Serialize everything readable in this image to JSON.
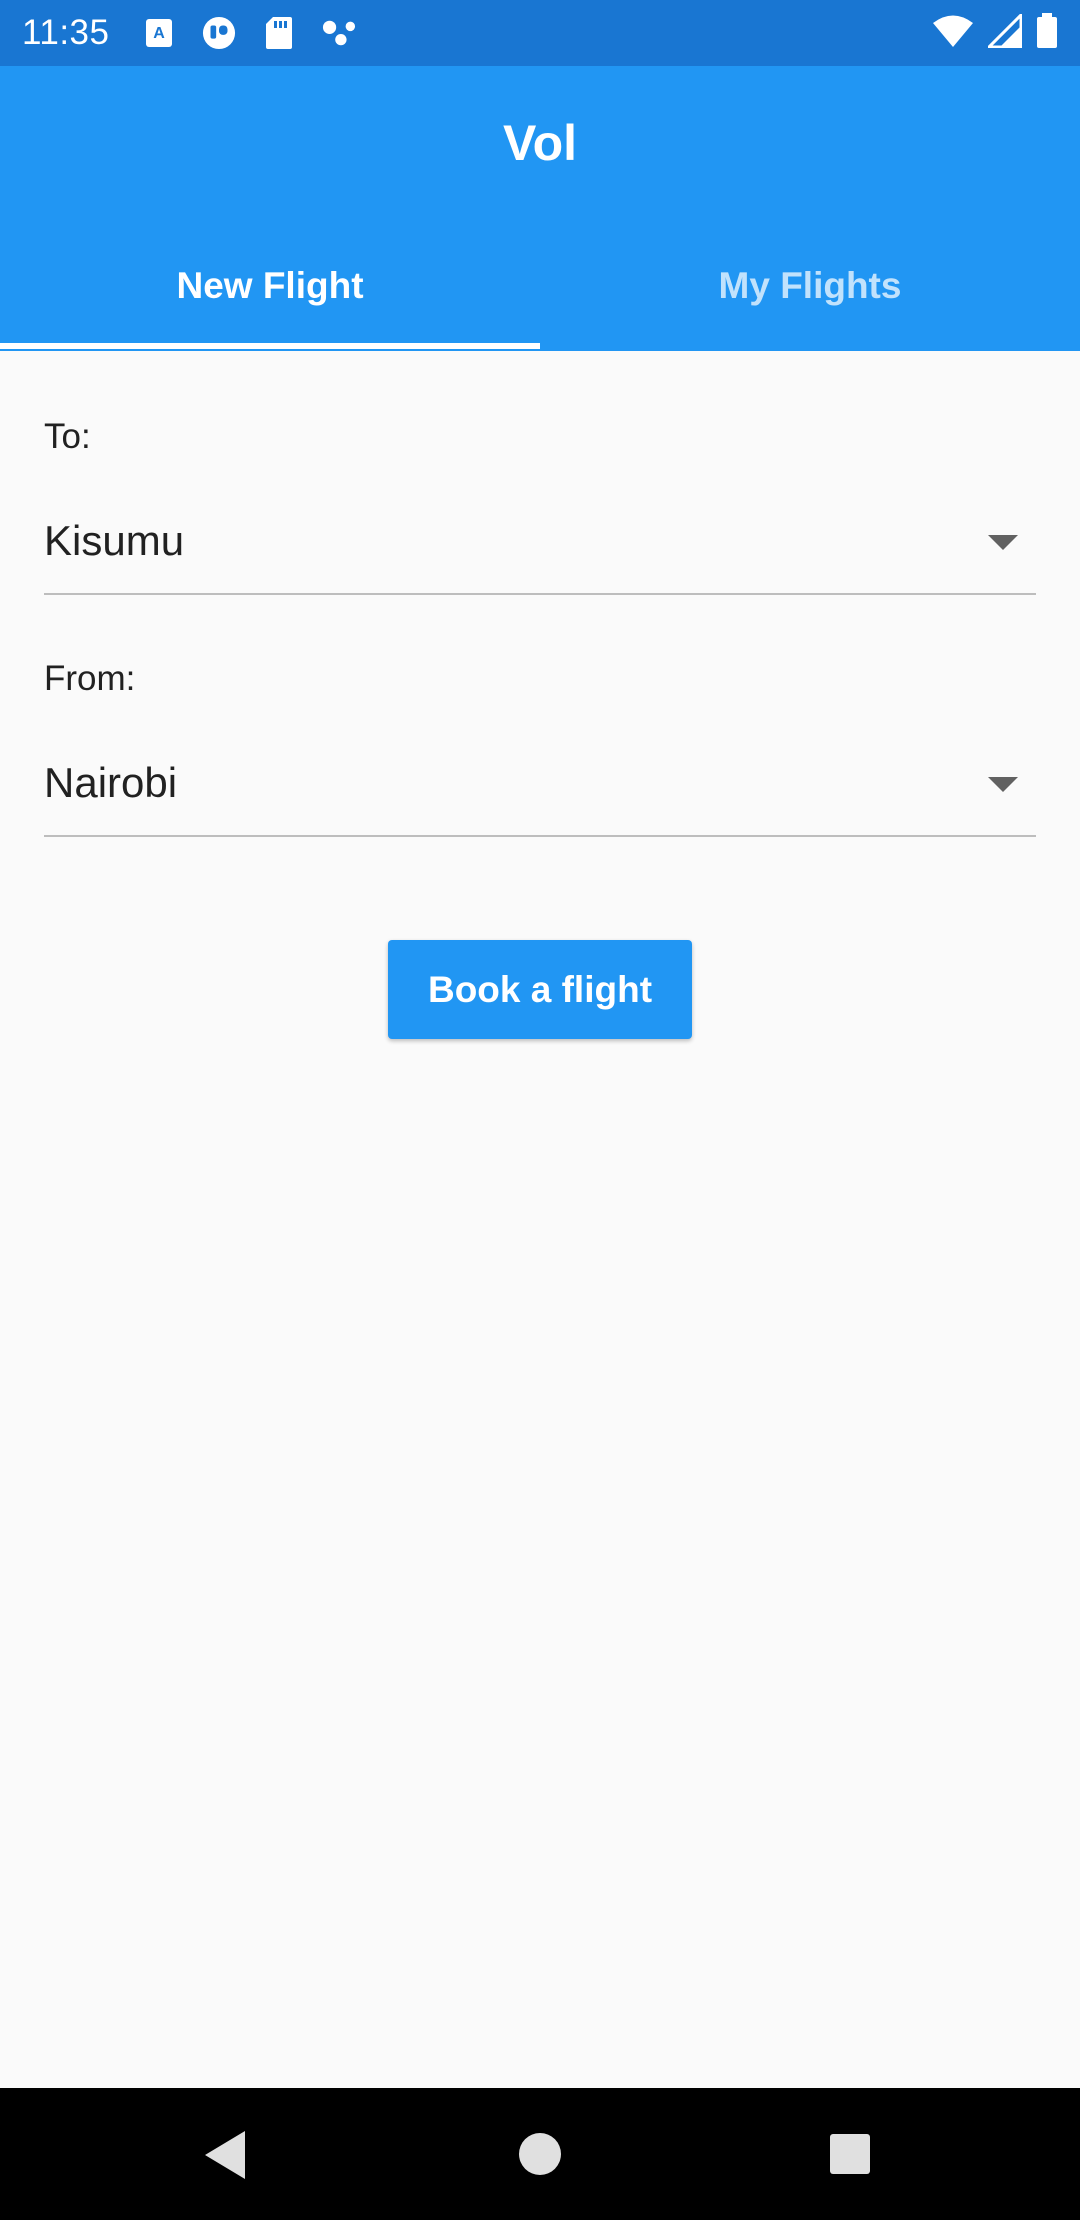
{
  "status_bar": {
    "time": "11:35",
    "icons_left": [
      "a-notification-icon",
      "camera-app-icon",
      "sd-card-icon",
      "connections-icon"
    ],
    "icons_right": [
      "wifi-icon",
      "cell-signal-icon",
      "battery-icon"
    ]
  },
  "app_bar": {
    "title": "Vol",
    "color": "#2196f3"
  },
  "tabs": [
    {
      "label": "New Flight",
      "selected": true
    },
    {
      "label": "My Flights",
      "selected": false
    }
  ],
  "form": {
    "to_label": "To:",
    "to_value": "Kisumu",
    "from_label": "From:",
    "from_value": "Nairobi",
    "book_button": "Book a flight"
  },
  "nav_bar": {
    "icons": [
      "back-icon",
      "home-icon",
      "recents-icon"
    ]
  }
}
